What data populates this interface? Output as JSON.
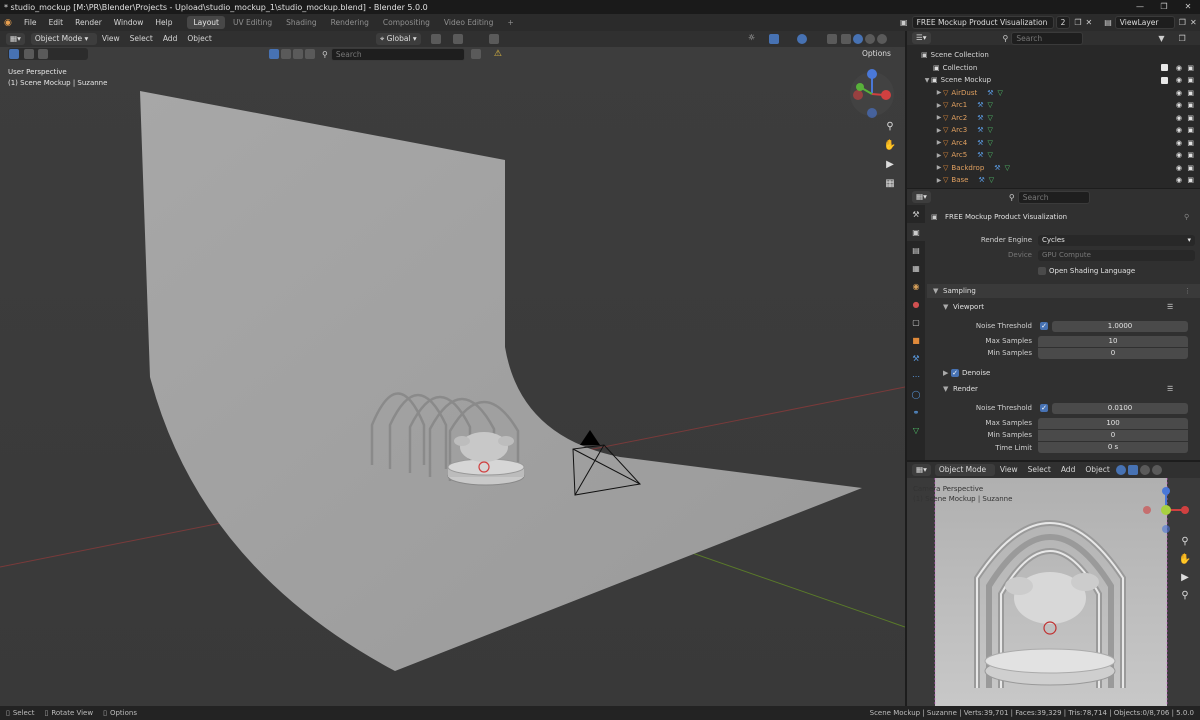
{
  "window": {
    "title": "* studio_mockup [M:\\PR\\Blender\\Projects - Upload\\studio_mockup_1\\studio_mockup.blend] - Blender 5.0.0"
  },
  "menubar": {
    "menus": [
      "File",
      "Edit",
      "Render",
      "Window",
      "Help"
    ],
    "workspaces": [
      "Layout",
      "UV Editing",
      "Shading",
      "Rendering",
      "Compositing",
      "Video Editing"
    ],
    "active_workspace": "Layout",
    "add_workspace": "+",
    "scene_name": "FREE Mockup Product Visualization",
    "scene_users": "2",
    "view_layer": "ViewLayer"
  },
  "viewport_header": {
    "mode": "Object Mode",
    "menus": [
      "View",
      "Select",
      "Add",
      "Object"
    ],
    "orientation": "Global",
    "search_placeholder": "Search",
    "options": "Options"
  },
  "viewport": {
    "perspective": "User Perspective",
    "collection_info": "(1) Scene Mockup | Suzanne"
  },
  "outliner": {
    "search_placeholder": "Search",
    "root": "Scene Collection",
    "items": [
      {
        "label": "Collection",
        "level": 1
      },
      {
        "label": "Scene Mockup",
        "level": 1
      },
      {
        "label": "AirDust",
        "level": 2
      },
      {
        "label": "Arc1",
        "level": 2
      },
      {
        "label": "Arc2",
        "level": 2
      },
      {
        "label": "Arc3",
        "level": 2
      },
      {
        "label": "Arc4",
        "level": 2
      },
      {
        "label": "Arc5",
        "level": 2
      },
      {
        "label": "Backdrop",
        "level": 2
      },
      {
        "label": "Base",
        "level": 2
      }
    ]
  },
  "properties": {
    "search_placeholder": "Search",
    "scene_title": "FREE Mockup Product Visualization",
    "render_engine_label": "Render Engine",
    "render_engine": "Cycles",
    "device_label": "Device",
    "device": "GPU Compute",
    "osl_label": "Open Shading Language",
    "sampling": "Sampling",
    "viewport_section": "Viewport",
    "viewport_noise_threshold_label": "Noise Threshold",
    "viewport_noise_threshold": "1.0000",
    "viewport_max_samples_label": "Max Samples",
    "viewport_max_samples": "10",
    "viewport_min_samples_label": "Min Samples",
    "viewport_min_samples": "0",
    "denoise": "Denoise",
    "render_section": "Render",
    "render_noise_threshold_label": "Noise Threshold",
    "render_noise_threshold": "0.0100",
    "render_max_samples_label": "Max Samples",
    "render_max_samples": "100",
    "render_min_samples_label": "Min Samples",
    "render_min_samples": "0",
    "time_limit_label": "Time Limit",
    "time_limit": "0 s"
  },
  "camera_view": {
    "mode": "Object Mode",
    "menus": [
      "View",
      "Select",
      "Add",
      "Object"
    ],
    "perspective": "Camera Perspective",
    "collection_info": "(1) Scene Mockup | Suzanne"
  },
  "statusbar": {
    "select": "Select",
    "rotate": "Rotate View",
    "options": "Options",
    "stats": "Scene Mockup | Suzanne | Verts:39,701 | Faces:39,329 | Tris:78,714 | Objects:0/8,706 | 5.0.0"
  },
  "colors": {
    "accent": "#4772b3",
    "object_orange": "#e08a3a",
    "mesh_green": "#52c46c"
  }
}
